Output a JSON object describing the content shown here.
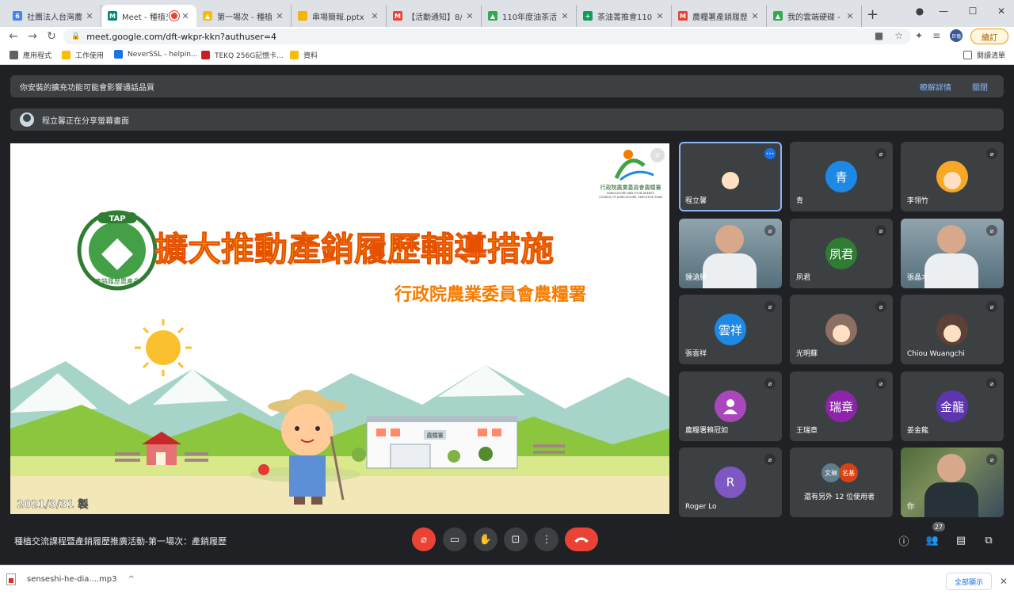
{
  "tabs": [
    {
      "title": "社團法人台灣農",
      "icon_color": "#4285f4",
      "icon": "6"
    },
    {
      "title": "Meet - 種植交",
      "icon_color": "#00897b",
      "icon": "M",
      "recording": true
    },
    {
      "title": "第一場次 - 種植交",
      "icon_color": "#fbbc04",
      "icon": "▲"
    },
    {
      "title": "串場簡報.pptx - G",
      "icon_color": "#f4b400",
      "icon": ""
    },
    {
      "title": "【活動通知】8/6",
      "icon_color": "#ea4335",
      "icon": "M"
    },
    {
      "title": "110年度油茶活動",
      "icon_color": "#34a853",
      "icon": "▲"
    },
    {
      "title": "茶油菁推會110年",
      "icon_color": "#0f9d58",
      "icon": "+"
    },
    {
      "title": "農糧署產銷履歷",
      "icon_color": "#ea4335",
      "icon": "M"
    },
    {
      "title": "我的雲端硬碟 - Go",
      "icon_color": "#34a853",
      "icon": "▲"
    }
  ],
  "newtab": "+",
  "window": {
    "minimize": "—",
    "maximize": "☐",
    "close": "✕",
    "menu": "●"
  },
  "address": {
    "url": "meet.google.com/dft-wkpr-kkn?authuser=4",
    "update_label": "續訂",
    "avatar": "巨億"
  },
  "bookmarks": [
    {
      "label": "應用程式",
      "color": "#5f6368"
    },
    {
      "label": "工作使用",
      "color": "#fbbc04"
    },
    {
      "label": "NeverSSL - helpin...",
      "color": "#1a73e8"
    },
    {
      "label": "TEKQ 256G記憶卡...",
      "color": "#c5221f"
    },
    {
      "label": "資料",
      "color": "#fbbc04"
    }
  ],
  "reading_list": "閱讀清單",
  "banners": {
    "warning": "你安裝的擴充功能可能會影響通話品質",
    "learn_more": "瞭解詳情",
    "close": "關閉",
    "sharing": "程立馨正在分享螢幕畫面"
  },
  "slide": {
    "title": "擴大推動產銷履歷輔導措施",
    "subtitle": "行政院農業委員會農糧署",
    "agency_cn": "行政院農業委員會農糧署",
    "agency_en1": "AGRICULTURE AND FOOD AGENCY",
    "agency_en2": "COUNCIL OF AGRICULTURE, EXECUTIVE YUAN",
    "tap_logo": "TAP",
    "tap_ring": "產銷履歷農產品",
    "date": "2021/3/31 製",
    "barn_sign": "農糧署"
  },
  "participants": [
    {
      "name": "程立馨",
      "avatar": "",
      "color": "#3c4043",
      "photo": true,
      "active": true,
      "more": "•••"
    },
    {
      "name": "青",
      "avatar": "青",
      "color": "#1e88e5"
    },
    {
      "name": "李翎竹",
      "avatar": "",
      "color": "#f9a825",
      "photo": true
    },
    {
      "name": "鍾滄勝",
      "avatar": "",
      "color": "#3c4043",
      "video": true
    },
    {
      "name": "夙君",
      "avatar": "夙君",
      "color": "#2e7d32"
    },
    {
      "name": "張晶才",
      "avatar": "",
      "color": "#3c4043",
      "video": true
    },
    {
      "name": "張雲祥",
      "avatar": "雲祥",
      "color": "#1e88e5"
    },
    {
      "name": "光明蘇",
      "avatar": "",
      "color": "#8d6e63",
      "photo": true
    },
    {
      "name": "Chiou Wuangchi",
      "avatar": "",
      "color": "#5d4037",
      "photo": true
    },
    {
      "name": "農糧署賴冠如",
      "avatar": "",
      "color": "#ab47bc",
      "person": true
    },
    {
      "name": "王瑞章",
      "avatar": "瑞章",
      "color": "#8e24aa"
    },
    {
      "name": "姜金龍",
      "avatar": "金龍",
      "color": "#5e35b1"
    },
    {
      "name": "Roger Lo",
      "avatar": "R",
      "color": "#7e57c2"
    },
    {
      "name": "還有另外 12 位使用者",
      "avatar": "",
      "color": "#3c4043",
      "others": [
        "文琳",
        "名基"
      ]
    },
    {
      "name": "你",
      "avatar": "",
      "color": "#3c4043",
      "video": true,
      "self": true
    }
  ],
  "meeting": {
    "title": "種植交流課程暨產銷履歷推廣活動-第一場次：產銷履歷",
    "participant_count": "27"
  },
  "download": {
    "file": "senseshi-he-dia....mp3",
    "show_all": "全部顯示",
    "chevron": "^",
    "close": "✕"
  }
}
